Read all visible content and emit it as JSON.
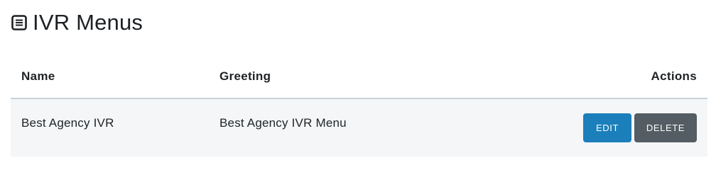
{
  "header": {
    "title": "IVR Menus",
    "icon": "list-box-icon"
  },
  "table": {
    "columns": {
      "name": "Name",
      "greeting": "Greeting",
      "actions": "Actions"
    },
    "rows": [
      {
        "name": "Best Agency IVR",
        "greeting": "Best Agency IVR Menu",
        "edit_label": "EDIT",
        "delete_label": "DELETE"
      }
    ]
  },
  "colors": {
    "edit_button": "#1a7fba",
    "delete_button": "#535d63",
    "row_background": "#f4f6f8",
    "header_border": "#c9d1d9"
  }
}
